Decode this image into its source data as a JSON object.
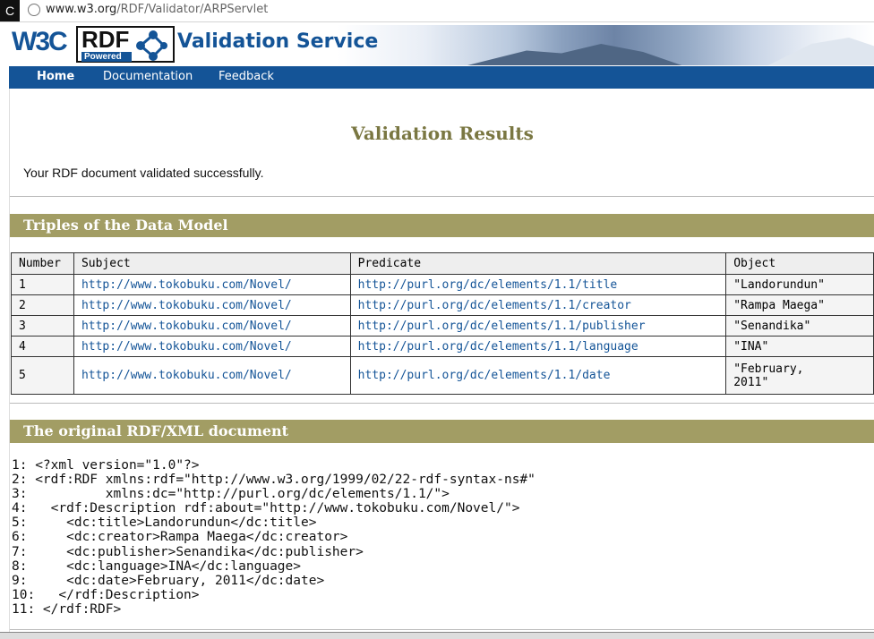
{
  "browser": {
    "back_glyph": "C",
    "url_host": "www.w3.org",
    "url_path": "/RDF/Validator/ARPServlet"
  },
  "header": {
    "logo_text": "W3C",
    "rdf_logo_text": "RDF",
    "rdf_logo_sub": "Powered",
    "service_title": "Validation Service"
  },
  "nav": {
    "items": [
      "Home",
      "Documentation",
      "Feedback"
    ]
  },
  "main": {
    "title": "Validation Results",
    "message": "Your RDF document validated successfully.",
    "triples_heading": "Triples of the Data Model",
    "original_heading": "The original RDF/XML document"
  },
  "table": {
    "headers": [
      "Number",
      "Subject",
      "Predicate",
      "Object"
    ],
    "rows": [
      {
        "number": "1",
        "subject": "http://www.tokobuku.com/Novel/",
        "predicate": "http://purl.org/dc/elements/1.1/title",
        "object": "\"Landorundun\""
      },
      {
        "number": "2",
        "subject": "http://www.tokobuku.com/Novel/",
        "predicate": "http://purl.org/dc/elements/1.1/creator",
        "object": "\"Rampa Maega\""
      },
      {
        "number": "3",
        "subject": "http://www.tokobuku.com/Novel/",
        "predicate": "http://purl.org/dc/elements/1.1/publisher",
        "object": "\"Senandika\""
      },
      {
        "number": "4",
        "subject": "http://www.tokobuku.com/Novel/",
        "predicate": "http://purl.org/dc/elements/1.1/language",
        "object": "\"INA\""
      },
      {
        "number": "5",
        "subject": "http://www.tokobuku.com/Novel/",
        "predicate": "http://purl.org/dc/elements/1.1/date",
        "object": "\"February,\n2011\""
      }
    ]
  },
  "source_lines": [
    "1: <?xml version=\"1.0\"?>",
    "2: <rdf:RDF xmlns:rdf=\"http://www.w3.org/1999/02/22-rdf-syntax-ns#\"",
    "3:          xmlns:dc=\"http://purl.org/dc/elements/1.1/\">",
    "4:   <rdf:Description rdf:about=\"http://www.tokobuku.com/Novel/\">",
    "5:     <dc:title>Landorundun</dc:title>",
    "6:     <dc:creator>Rampa Maega</dc:creator>",
    "7:     <dc:publisher>Senandika</dc:publisher>",
    "8:     <dc:language>INA</dc:language>",
    "9:     <dc:date>February, 2011</dc:date>",
    "10:   </rdf:Description>",
    "11: </rdf:RDF>"
  ],
  "colors": {
    "brand_blue": "#145497",
    "section_bar": "#a29d64",
    "title_olive": "#7a7742"
  }
}
